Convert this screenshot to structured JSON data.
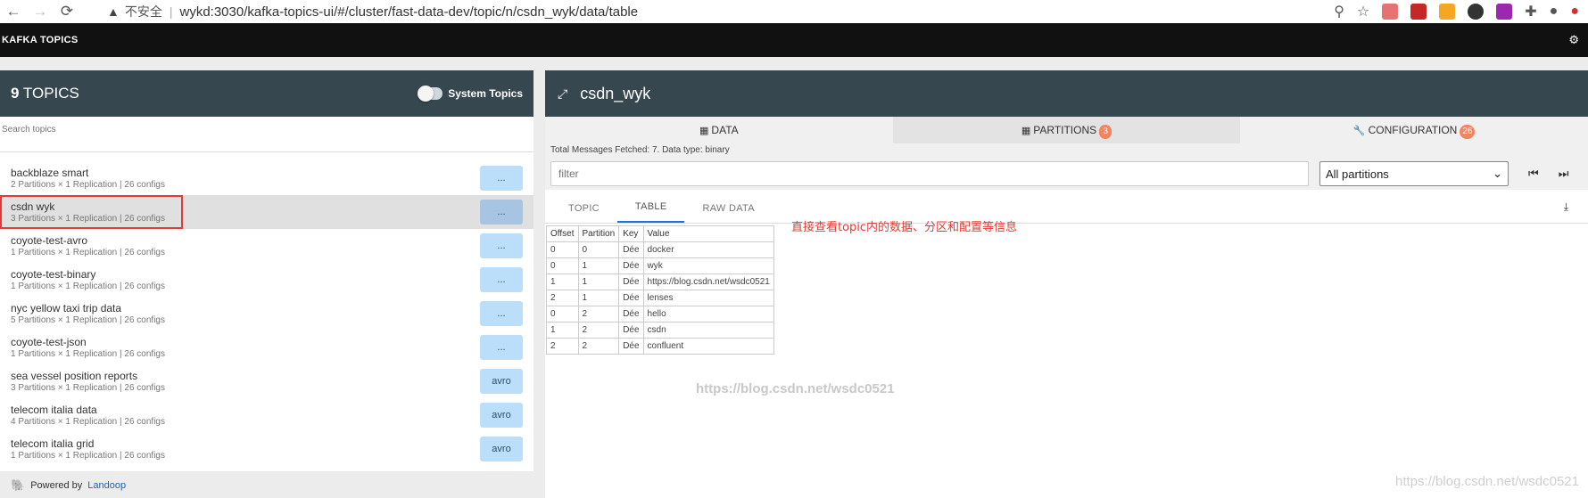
{
  "browser": {
    "security_label": "不安全",
    "url": "wykd:3030/kafka-topics-ui/#/cluster/fast-data-dev/topic/n/csdn_wyk/data/table"
  },
  "app": {
    "brand": "KAFKA TOPICS"
  },
  "left": {
    "topics_count": "9",
    "topics_label": "TOPICS",
    "system_topics_label": "System Topics",
    "search_placeholder": "Search topics",
    "topics": [
      {
        "name": "backblaze smart",
        "meta": "2 Partitions × 1 Replication | 26 configs",
        "btn": "..."
      },
      {
        "name": "csdn wyk",
        "meta": "3 Partitions × 1 Replication | 26 configs",
        "btn": "..."
      },
      {
        "name": "coyote-test-avro",
        "meta": "1 Partitions × 1 Replication | 26 configs",
        "btn": "..."
      },
      {
        "name": "coyote-test-binary",
        "meta": "1 Partitions × 1 Replication | 26 configs",
        "btn": "..."
      },
      {
        "name": "nyc yellow taxi trip data",
        "meta": "5 Partitions × 1 Replication | 26 configs",
        "btn": "..."
      },
      {
        "name": "coyote-test-json",
        "meta": "1 Partitions × 1 Replication | 26 configs",
        "btn": "..."
      },
      {
        "name": "sea vessel position reports",
        "meta": "3 Partitions × 1 Replication | 26 configs",
        "btn": "avro"
      },
      {
        "name": "telecom italia data",
        "meta": "4 Partitions × 1 Replication | 26 configs",
        "btn": "avro"
      },
      {
        "name": "telecom italia grid",
        "meta": "1 Partitions × 1 Replication | 26 configs",
        "btn": "avro"
      }
    ],
    "powered_by": "Powered by",
    "powered_link": "Landoop"
  },
  "right": {
    "topic_title": "csdn_wyk",
    "tabs": {
      "data": "DATA",
      "partitions": "PARTITIONS",
      "partitions_count": "3",
      "configuration": "CONFIGURATION",
      "configuration_count": "26"
    },
    "info": "Total Messages Fetched: 7. Data type: binary",
    "filter_placeholder": "filter",
    "partition_select": "All partitions",
    "subtabs": {
      "topic": "TOPIC",
      "table": "TABLE",
      "raw": "RAW DATA"
    },
    "annotation": "直接查看topic内的数据、分区和配置等信息",
    "table": {
      "headers": [
        "Offset",
        "Partition",
        "Key",
        "Value"
      ],
      "rows": [
        [
          "0",
          "0",
          "Dée",
          "docker"
        ],
        [
          "0",
          "1",
          "Dée",
          "wyk"
        ],
        [
          "1",
          "1",
          "Dée",
          "https://blog.csdn.net/wsdc0521"
        ],
        [
          "2",
          "1",
          "Dée",
          "lenses"
        ],
        [
          "0",
          "2",
          "Dée",
          "hello"
        ],
        [
          "1",
          "2",
          "Dée",
          "csdn"
        ],
        [
          "2",
          "2",
          "Dée",
          "confluent"
        ]
      ]
    }
  },
  "watermarks": {
    "center": "https://blog.csdn.net/wsdc0521",
    "corner": "https://blog.csdn.net/wsdc0521"
  }
}
